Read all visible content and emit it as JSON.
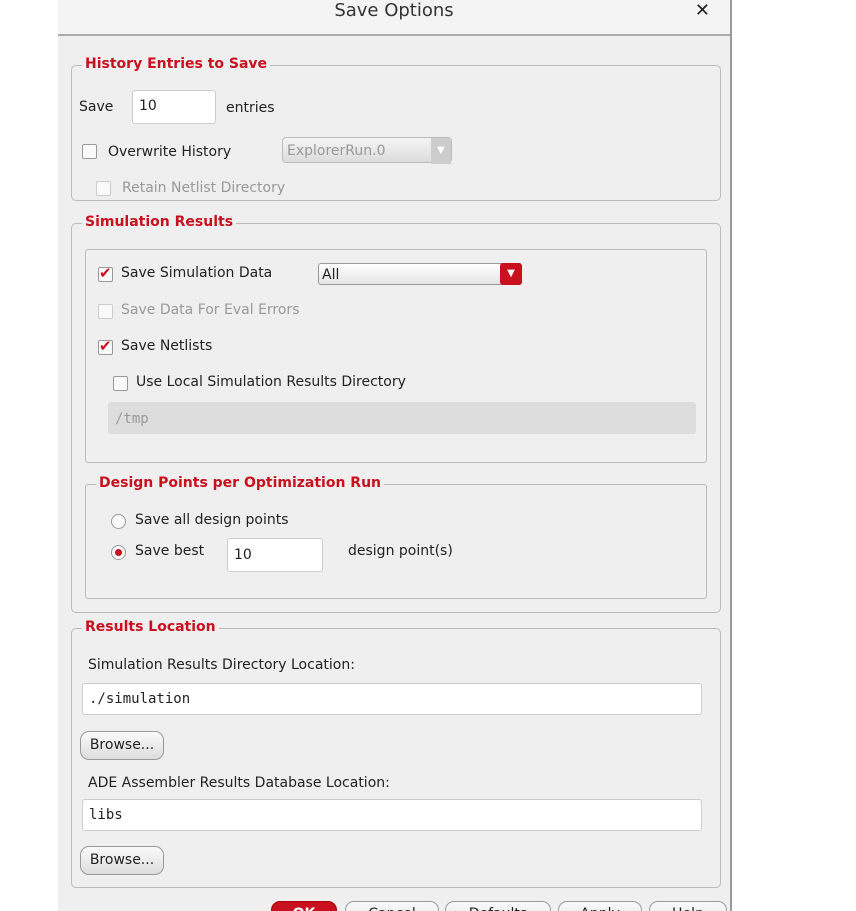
{
  "title": "Save Options",
  "history": {
    "legend": "History Entries to Save",
    "save_label": "Save",
    "save_value": "10",
    "entries_label": "entries",
    "overwrite_label": "Overwrite History",
    "overwrite_checked": false,
    "run_select": "ExplorerRun.0",
    "retain_label": "Retain Netlist Directory"
  },
  "sim": {
    "legend": "Simulation Results",
    "save_sim_label": "Save Simulation Data",
    "save_sim_select": "All",
    "eval_label": "Save Data For Eval Errors",
    "netlists_label": "Save Netlists",
    "local_label": "Use Local Simulation Results Directory",
    "local_dir": "/tmp"
  },
  "design": {
    "legend": "Design Points per Optimization Run",
    "all_label": "Save all design points",
    "best_label": "Save best",
    "best_value": "10",
    "points_label": "design point(s)"
  },
  "location": {
    "legend": "Results Location",
    "sim_dir_label": "Simulation Results Directory Location:",
    "sim_dir": "./simulation",
    "browse": "Browse...",
    "db_label": "ADE Assembler Results Database Location:",
    "db_dir": "libs"
  },
  "buttons": {
    "ok": "OK",
    "cancel": "Cancel",
    "defaults": "Defaults",
    "apply": "Apply",
    "help": "Help"
  }
}
